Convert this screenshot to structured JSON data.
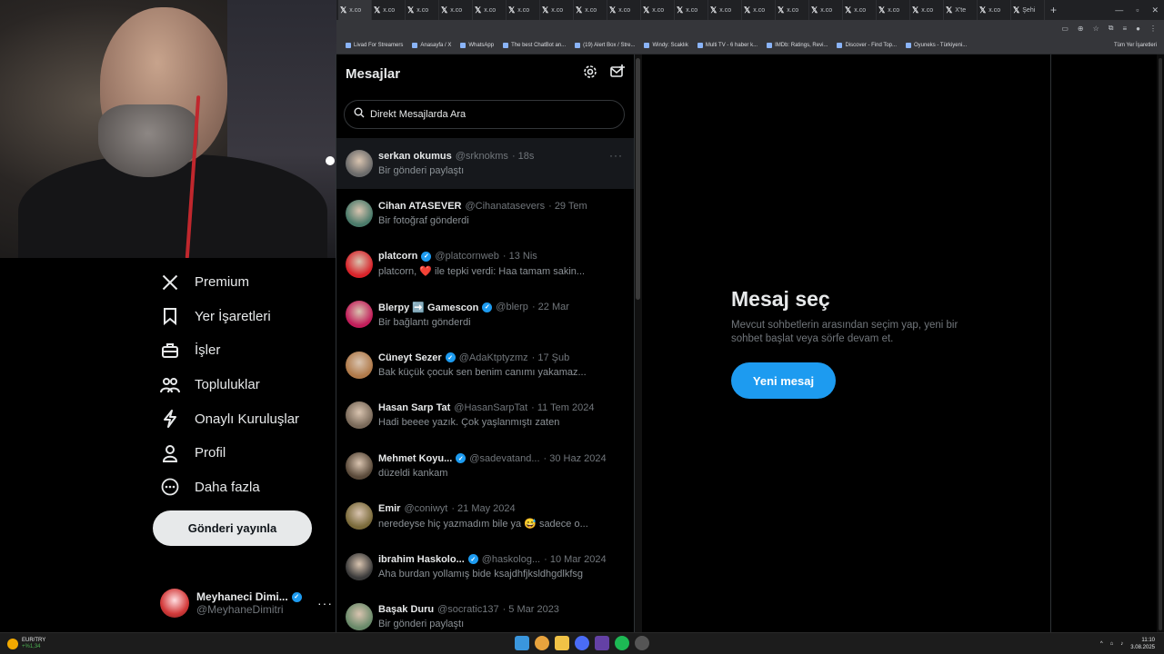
{
  "browser": {
    "tabs": [
      "x.co",
      "x.co",
      "x.co",
      "x.co",
      "x.co",
      "x.co",
      "x.co",
      "x.co",
      "x.co",
      "x.co",
      "x.co",
      "x.co",
      "x.co",
      "x.co",
      "x.co",
      "x.co",
      "x.co",
      "x.co",
      "X'te",
      "x.co",
      "Şehi"
    ],
    "new_tab": "+",
    "bookmarks": [
      "Livad For Streamers",
      "Anasayfa / X",
      "WhatsApp",
      "The best ChatBot an...",
      "(19) Alert Box / Stre...",
      "Windy: Scaklık",
      "Multi TV - 6 haber k...",
      "IMDb: Ratings, Revi...",
      "Discover - Find Top...",
      "Oyuneks - Türkiyeni..."
    ],
    "bookmarks_folder": "Tüm Yer İşaretleri",
    "window_controls": [
      "—",
      "▫",
      "✕"
    ]
  },
  "nav": {
    "items": [
      {
        "label": "Premium",
        "icon": "x-logo-icon"
      },
      {
        "label": "Yer İşaretleri",
        "icon": "bookmark-icon"
      },
      {
        "label": "İşler",
        "icon": "briefcase-icon"
      },
      {
        "label": "Topluluklar",
        "icon": "communities-icon"
      },
      {
        "label": "Onaylı Kuruluşlar",
        "icon": "lightning-icon"
      },
      {
        "label": "Profil",
        "icon": "person-icon"
      },
      {
        "label": "Daha fazla",
        "icon": "more-circle-icon"
      }
    ],
    "post_button": "Gönderi yayınla",
    "profile": {
      "name": "Meyhaneci Dimi...",
      "handle": "@MeyhaneDimitri"
    }
  },
  "messages": {
    "title": "Mesajlar",
    "search_placeholder": "Direkt Mesajlarda Ara",
    "conversations": [
      {
        "name": "serkan okumus",
        "verified": false,
        "handle": "@srknokms",
        "date": "· 18s",
        "preview": "Bir gönderi paylaştı"
      },
      {
        "name": "Cihan ATASEVER",
        "verified": false,
        "handle": "@Cihanatasevers",
        "date": "· 29 Tem",
        "preview": "Bir fotoğraf gönderdi"
      },
      {
        "name": "platcorn",
        "verified": true,
        "handle": "@platcornweb",
        "date": "· 13 Nis",
        "preview": "platcorn, ❤️ ile tepki verdi: Haa tamam sakin..."
      },
      {
        "name": "Blerpy ➡️ Gamescon",
        "verified": true,
        "handle": "@blerp",
        "date": "· 22 Mar",
        "preview": "Bir bağlantı gönderdi"
      },
      {
        "name": "Cüneyt Sezer",
        "verified": true,
        "handle": "@AdaKtptyzmz",
        "date": "· 17 Şub",
        "preview": "Bak küçük çocuk sen benim canımı yakamaz..."
      },
      {
        "name": "Hasan Sarp Tat",
        "verified": false,
        "handle": "@HasanSarpTat",
        "date": "· 11 Tem 2024",
        "preview": "Hadi beeee yazık. Çok yaşlanmıştı zaten"
      },
      {
        "name": "Mehmet Koyu...",
        "verified": true,
        "handle": "@sadevatand...",
        "date": "· 30 Haz 2024",
        "preview": "düzeldi kankam"
      },
      {
        "name": "Emir",
        "verified": false,
        "handle": "@coniwyt",
        "date": "· 21 May 2024",
        "preview": "neredeyse hiç yazmadım bile ya 😅 sadece o..."
      },
      {
        "name": "ibrahim Haskolo...",
        "verified": true,
        "handle": "@haskolog...",
        "date": "· 10 Mar 2024",
        "preview": "Aha burdan yollamış bide ksajdhfjksldhgdlkfsg"
      },
      {
        "name": "Başak Duru",
        "verified": false,
        "handle": "@socratic137",
        "date": "· 5 Mar 2023",
        "preview": "Bir gönderi paylaştı"
      }
    ]
  },
  "empty_state": {
    "title": "Mesaj seç",
    "description": "Mevcut sohbetlerin arasından seçim yap, yeni bir sohbet başlat veya sörfe devam et.",
    "button": "Yeni mesaj"
  },
  "taskbar": {
    "ticker_name": "EUR/TRY",
    "ticker_change": "+%1,34",
    "time": "11:10",
    "date": "3.08.2025"
  },
  "colors": {
    "accent": "#1d9bf0",
    "background": "#000000",
    "text": "#e7e9ea",
    "muted": "#71767b"
  }
}
